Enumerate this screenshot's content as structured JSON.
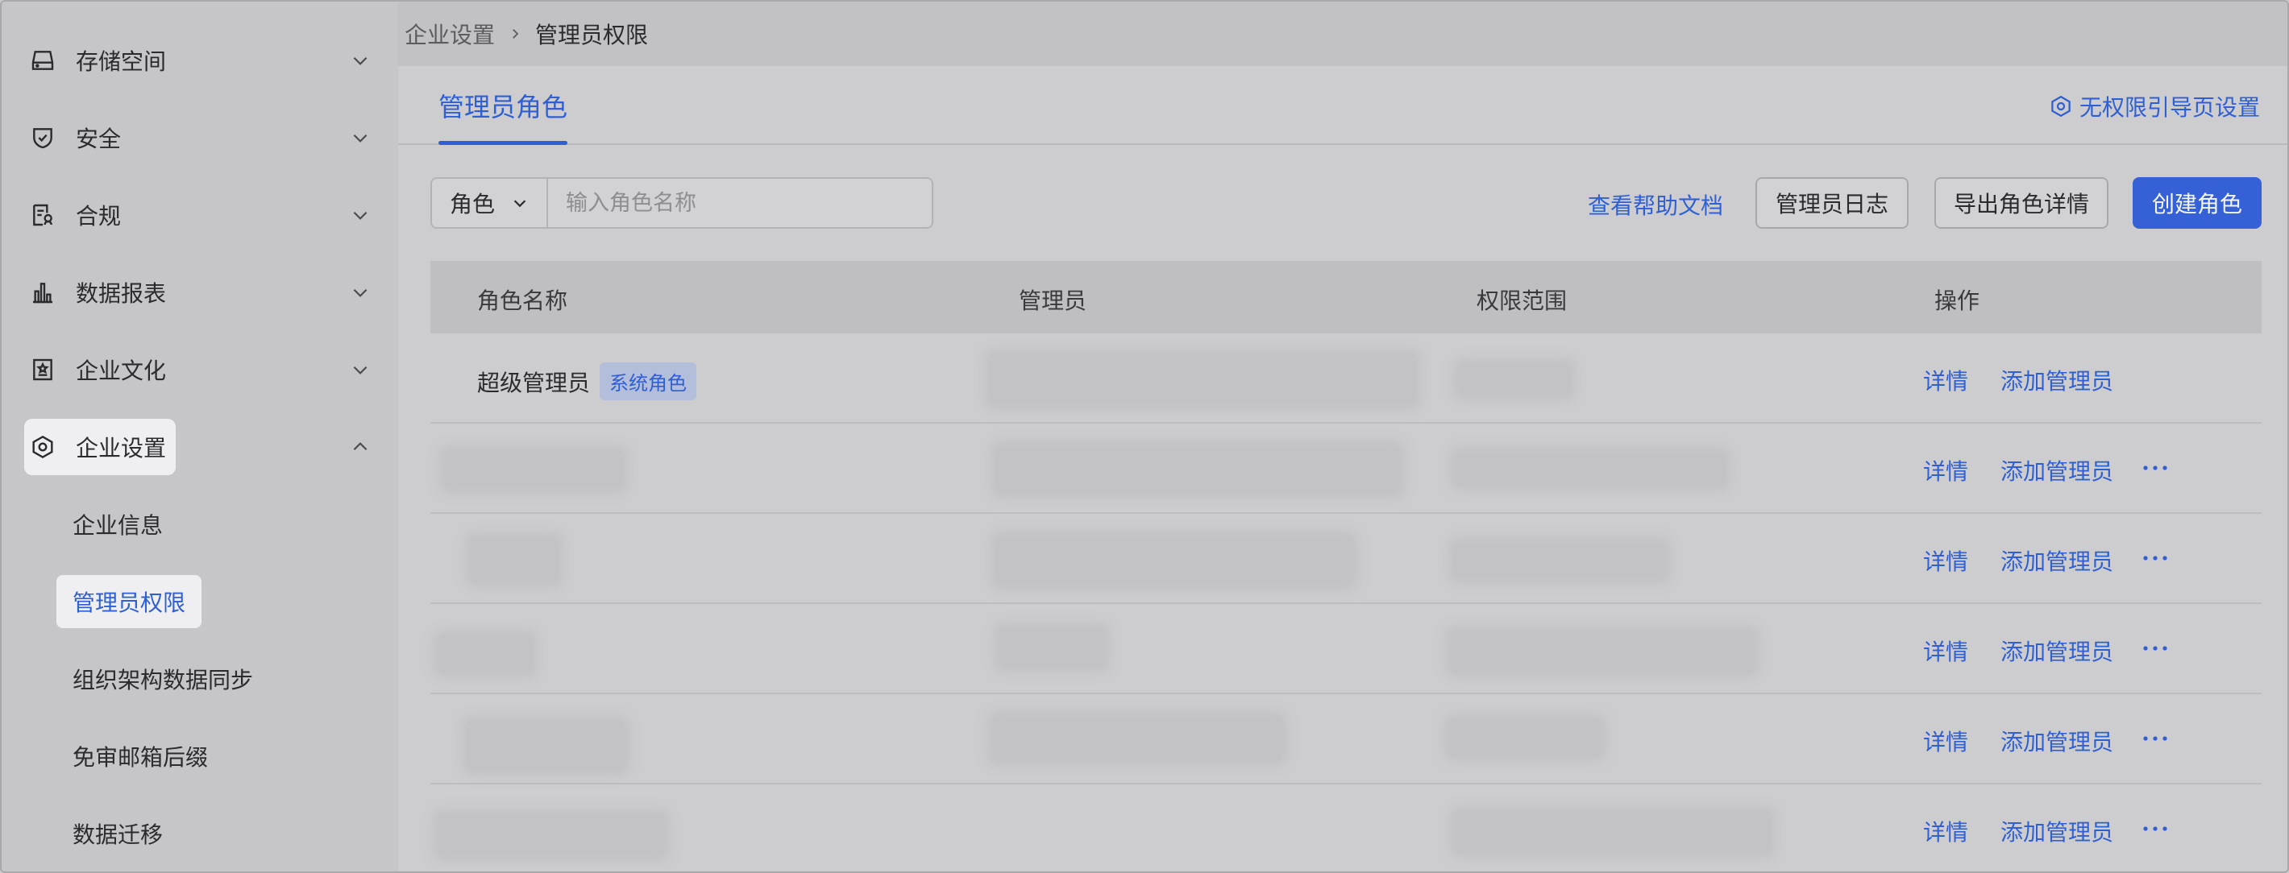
{
  "sidebar": {
    "items": [
      {
        "label": "存储空间",
        "icon": "storage-icon",
        "expanded": false
      },
      {
        "label": "安全",
        "icon": "shield-icon",
        "expanded": false
      },
      {
        "label": "合规",
        "icon": "compliance-icon",
        "expanded": false
      },
      {
        "label": "数据报表",
        "icon": "bar-chart-icon",
        "expanded": false
      },
      {
        "label": "企业文化",
        "icon": "culture-icon",
        "expanded": false
      },
      {
        "label": "企业设置",
        "icon": "hexagon-gear-icon",
        "expanded": true
      }
    ],
    "subitems": [
      {
        "label": "企业信息",
        "selected": false
      },
      {
        "label": "管理员权限",
        "selected": true
      },
      {
        "label": "组织架构数据同步",
        "selected": false
      },
      {
        "label": "免审邮箱后缀",
        "selected": false
      },
      {
        "label": "数据迁移",
        "selected": false
      }
    ]
  },
  "breadcrumb": {
    "parent": "企业设置",
    "current": "管理员权限"
  },
  "tabs": {
    "active": "管理员角色",
    "guide_link": "无权限引导页设置"
  },
  "toolbar": {
    "filter_select": "角色",
    "search_placeholder": "输入角色名称",
    "help_link": "查看帮助文档",
    "log_button": "管理员日志",
    "export_button": "导出角色详情",
    "create_button": "创建角色"
  },
  "table": {
    "headers": {
      "name": "角色名称",
      "admins": "管理员",
      "scope": "权限范围",
      "actions": "操作"
    },
    "first_row": {
      "name": "超级管理员",
      "tag": "系统角色"
    },
    "action_detail": "详情",
    "action_add": "添加管理员"
  },
  "colors": {
    "accent": "#2f5fd4",
    "primary_button": "#3661d6"
  }
}
